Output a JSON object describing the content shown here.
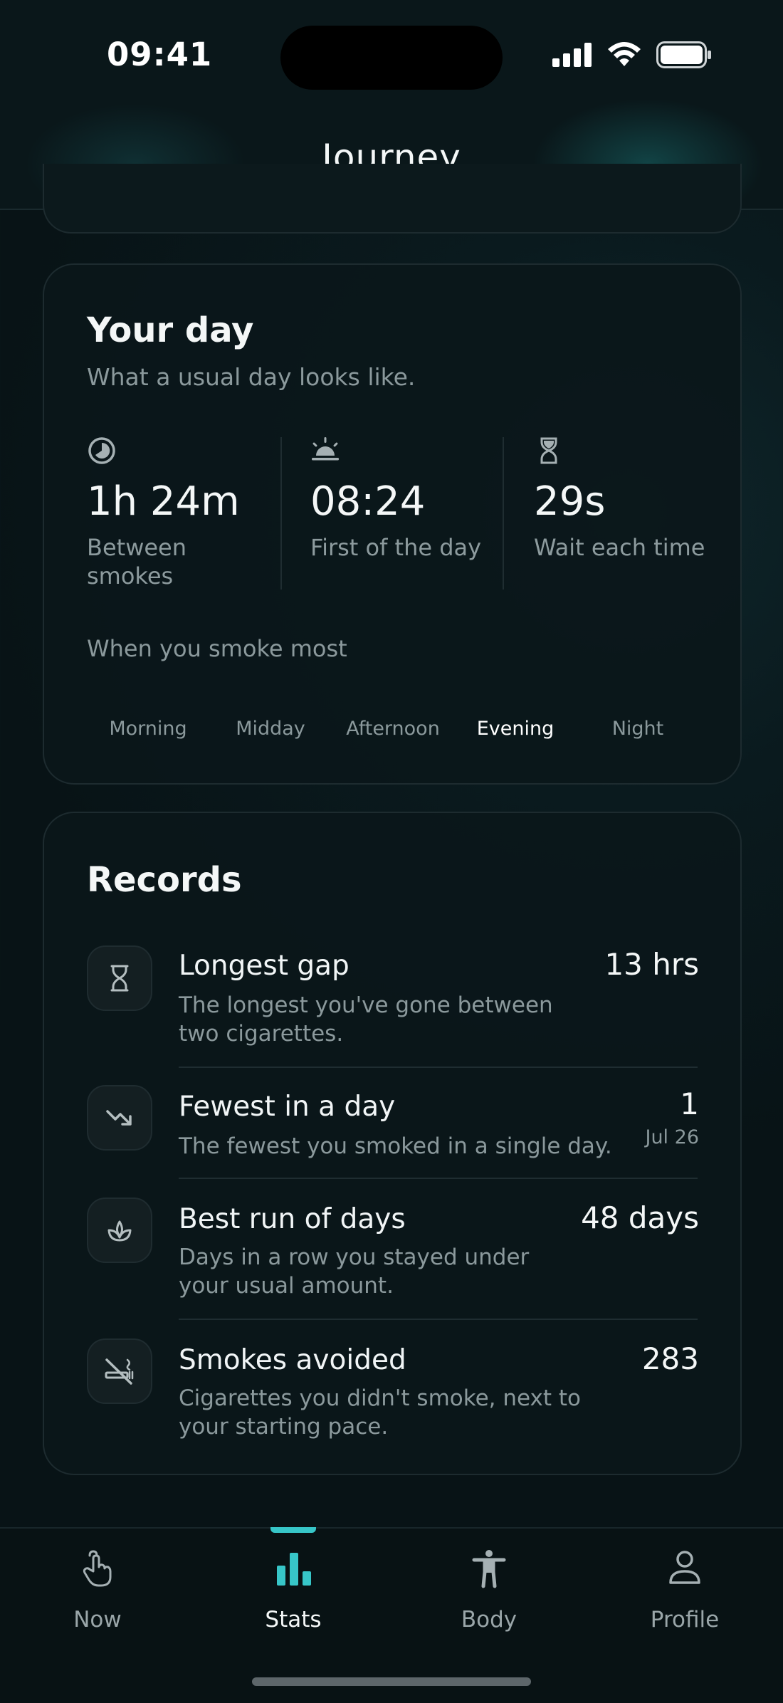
{
  "status": {
    "time": "09:41"
  },
  "header": {
    "title": "Journey"
  },
  "day_card": {
    "title": "Your day",
    "subtitle": "What a usual day looks like.",
    "stats": [
      {
        "icon": "clock-pie-icon",
        "value": "1h 24m",
        "label": "Between smokes"
      },
      {
        "icon": "sunrise-icon",
        "value": "08:24",
        "label": "First of the day"
      },
      {
        "icon": "hourglass-icon",
        "value": "29s",
        "label": "Wait each time"
      }
    ],
    "smoke_most_label": "When you smoke most",
    "periods": [
      "Morning",
      "Midday",
      "Afternoon",
      "Evening",
      "Night"
    ],
    "active_period": "Evening"
  },
  "records": {
    "title": "Records",
    "items": [
      {
        "icon": "hourglass-icon",
        "title": "Longest gap",
        "description": "The longest you've gone between two cigarettes.",
        "value": "13 hrs"
      },
      {
        "icon": "trend-down-icon",
        "title": "Fewest in a day",
        "description": "The fewest you smoked in a single day.",
        "value": "1",
        "date": "Jul 26"
      },
      {
        "icon": "sprout-icon",
        "title": "Best run of days",
        "description": "Days in a row you stayed under your usual amount.",
        "value": "48 days"
      },
      {
        "icon": "no-smoking-icon",
        "title": "Smokes avoided",
        "description": "Cigarettes you didn't smoke, next to your starting pace.",
        "value": "283"
      }
    ]
  },
  "tabbar": {
    "tabs": [
      {
        "icon": "tap-hand-icon",
        "label": "Now"
      },
      {
        "icon": "bar-chart-icon",
        "label": "Stats"
      },
      {
        "icon": "body-icon",
        "label": "Body"
      },
      {
        "icon": "person-icon",
        "label": "Profile"
      }
    ],
    "active": "Stats"
  },
  "colors": {
    "accent": "#37c6c8",
    "background": "#0a1a1e",
    "muted_text": "#8b999c"
  }
}
